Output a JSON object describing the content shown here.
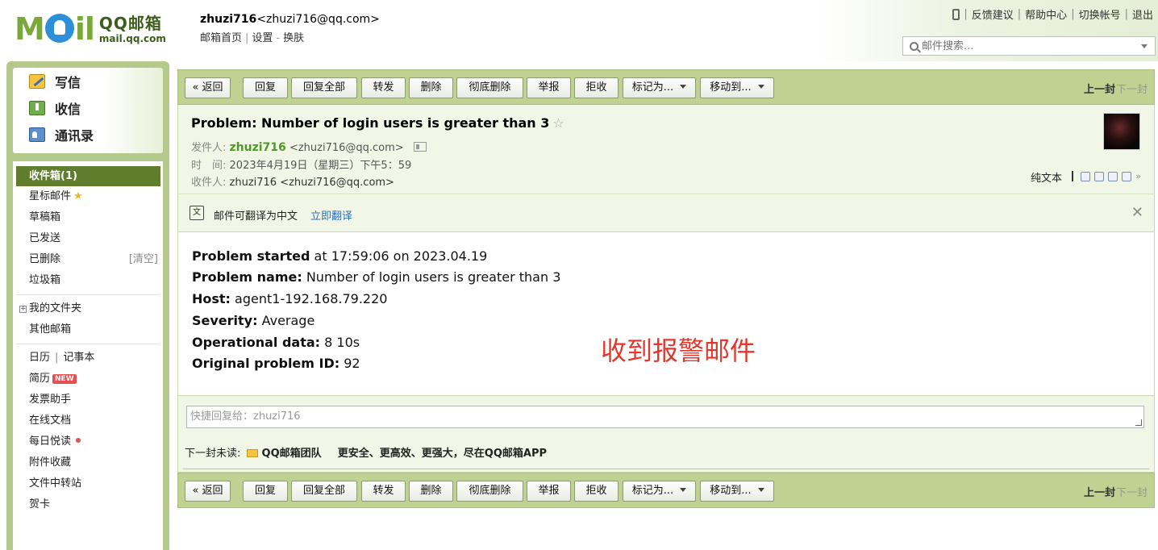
{
  "header": {
    "logo": {
      "mark": "MOil",
      "brand": "QQ邮箱",
      "domain": "mail.qq.com"
    },
    "user": {
      "name": "zhuzi716",
      "email": "<zhuzi716@qq.com>"
    },
    "nav": [
      "邮箱首页",
      "设置",
      "换肤"
    ],
    "toplinks": [
      "反馈建议",
      "帮助中心",
      "切换帐号",
      "退出"
    ],
    "search_placeholder": "邮件搜索..."
  },
  "compose": [
    {
      "label": "写信",
      "icon": "pen-icon"
    },
    {
      "label": "收信",
      "icon": "inbox-download-icon"
    },
    {
      "label": "通讯录",
      "icon": "contacts-card-icon"
    }
  ],
  "folders": {
    "inbox": "收件箱(1)",
    "starred": "星标邮件",
    "drafts": "草稿箱",
    "sent": "已发送",
    "deleted": "已删除",
    "deleted_action": "[清空]",
    "trash": "垃圾箱",
    "my_folders": "我的文件夹",
    "other": "其他邮箱",
    "calendar": "日历",
    "notes": "记事本",
    "resume": "简历",
    "resume_badge": "NEW",
    "invoice": "发票助手",
    "docs": "在线文档",
    "daily": "每日悦读",
    "attachments": "附件收藏",
    "transfer": "文件中转站",
    "cards": "贺卡"
  },
  "toolbar": {
    "back": "« 返回",
    "reply": "回复",
    "reply_all": "回复全部",
    "forward": "转发",
    "delete": "删除",
    "delete_perm": "彻底删除",
    "report": "举报",
    "reject": "拒收",
    "mark_as": "标记为...",
    "move_to": "移动到...",
    "prev": "上一封",
    "next": "下一封"
  },
  "mail": {
    "subject": "Problem: Number of login users is greater than 3",
    "from_label": "发件人:",
    "from_name": "zhuzi716",
    "from_email": "<zhuzi716@qq.com>",
    "time_label": "时　间:",
    "time": "2023年4月19日（星期三）下午5：59",
    "to_label": "收件人:",
    "to": "zhuzi716 <zhuzi716@qq.com>",
    "plain_text": "纯文本"
  },
  "translate": {
    "text": "邮件可翻译为中文",
    "link": "立即翻译"
  },
  "body": [
    {
      "key": "Problem started",
      "value": " at 17:59:06 on 2023.04.19"
    },
    {
      "key": "Problem name:",
      "value": " Number of login users is greater than 3"
    },
    {
      "key": "Host:",
      "value": " agent1-192.168.79.220"
    },
    {
      "key": "Severity:",
      "value": " Average"
    },
    {
      "key": "Operational data:",
      "value": " 8 10s"
    },
    {
      "key": "Original problem ID:",
      "value": " 92"
    }
  ],
  "annotation": "收到报警邮件",
  "quick_reply": {
    "placeholder": "快捷回复给：zhuzi716",
    "next_unread_label": "下一封未读:",
    "next_unread_sender": "QQ邮箱团队",
    "next_unread_subject": "更安全、更高效、更强大，尽在QQ邮箱APP"
  },
  "colors": {
    "brand_green": "#7aa83a",
    "toolbar_bg": "#bfd292",
    "header_bg": "#f1f6e7",
    "active_folder": "#5f7d2d",
    "sender_green": "#4e9a25",
    "annotation_red": "#e5362b",
    "link_blue": "#2a6fb8"
  }
}
